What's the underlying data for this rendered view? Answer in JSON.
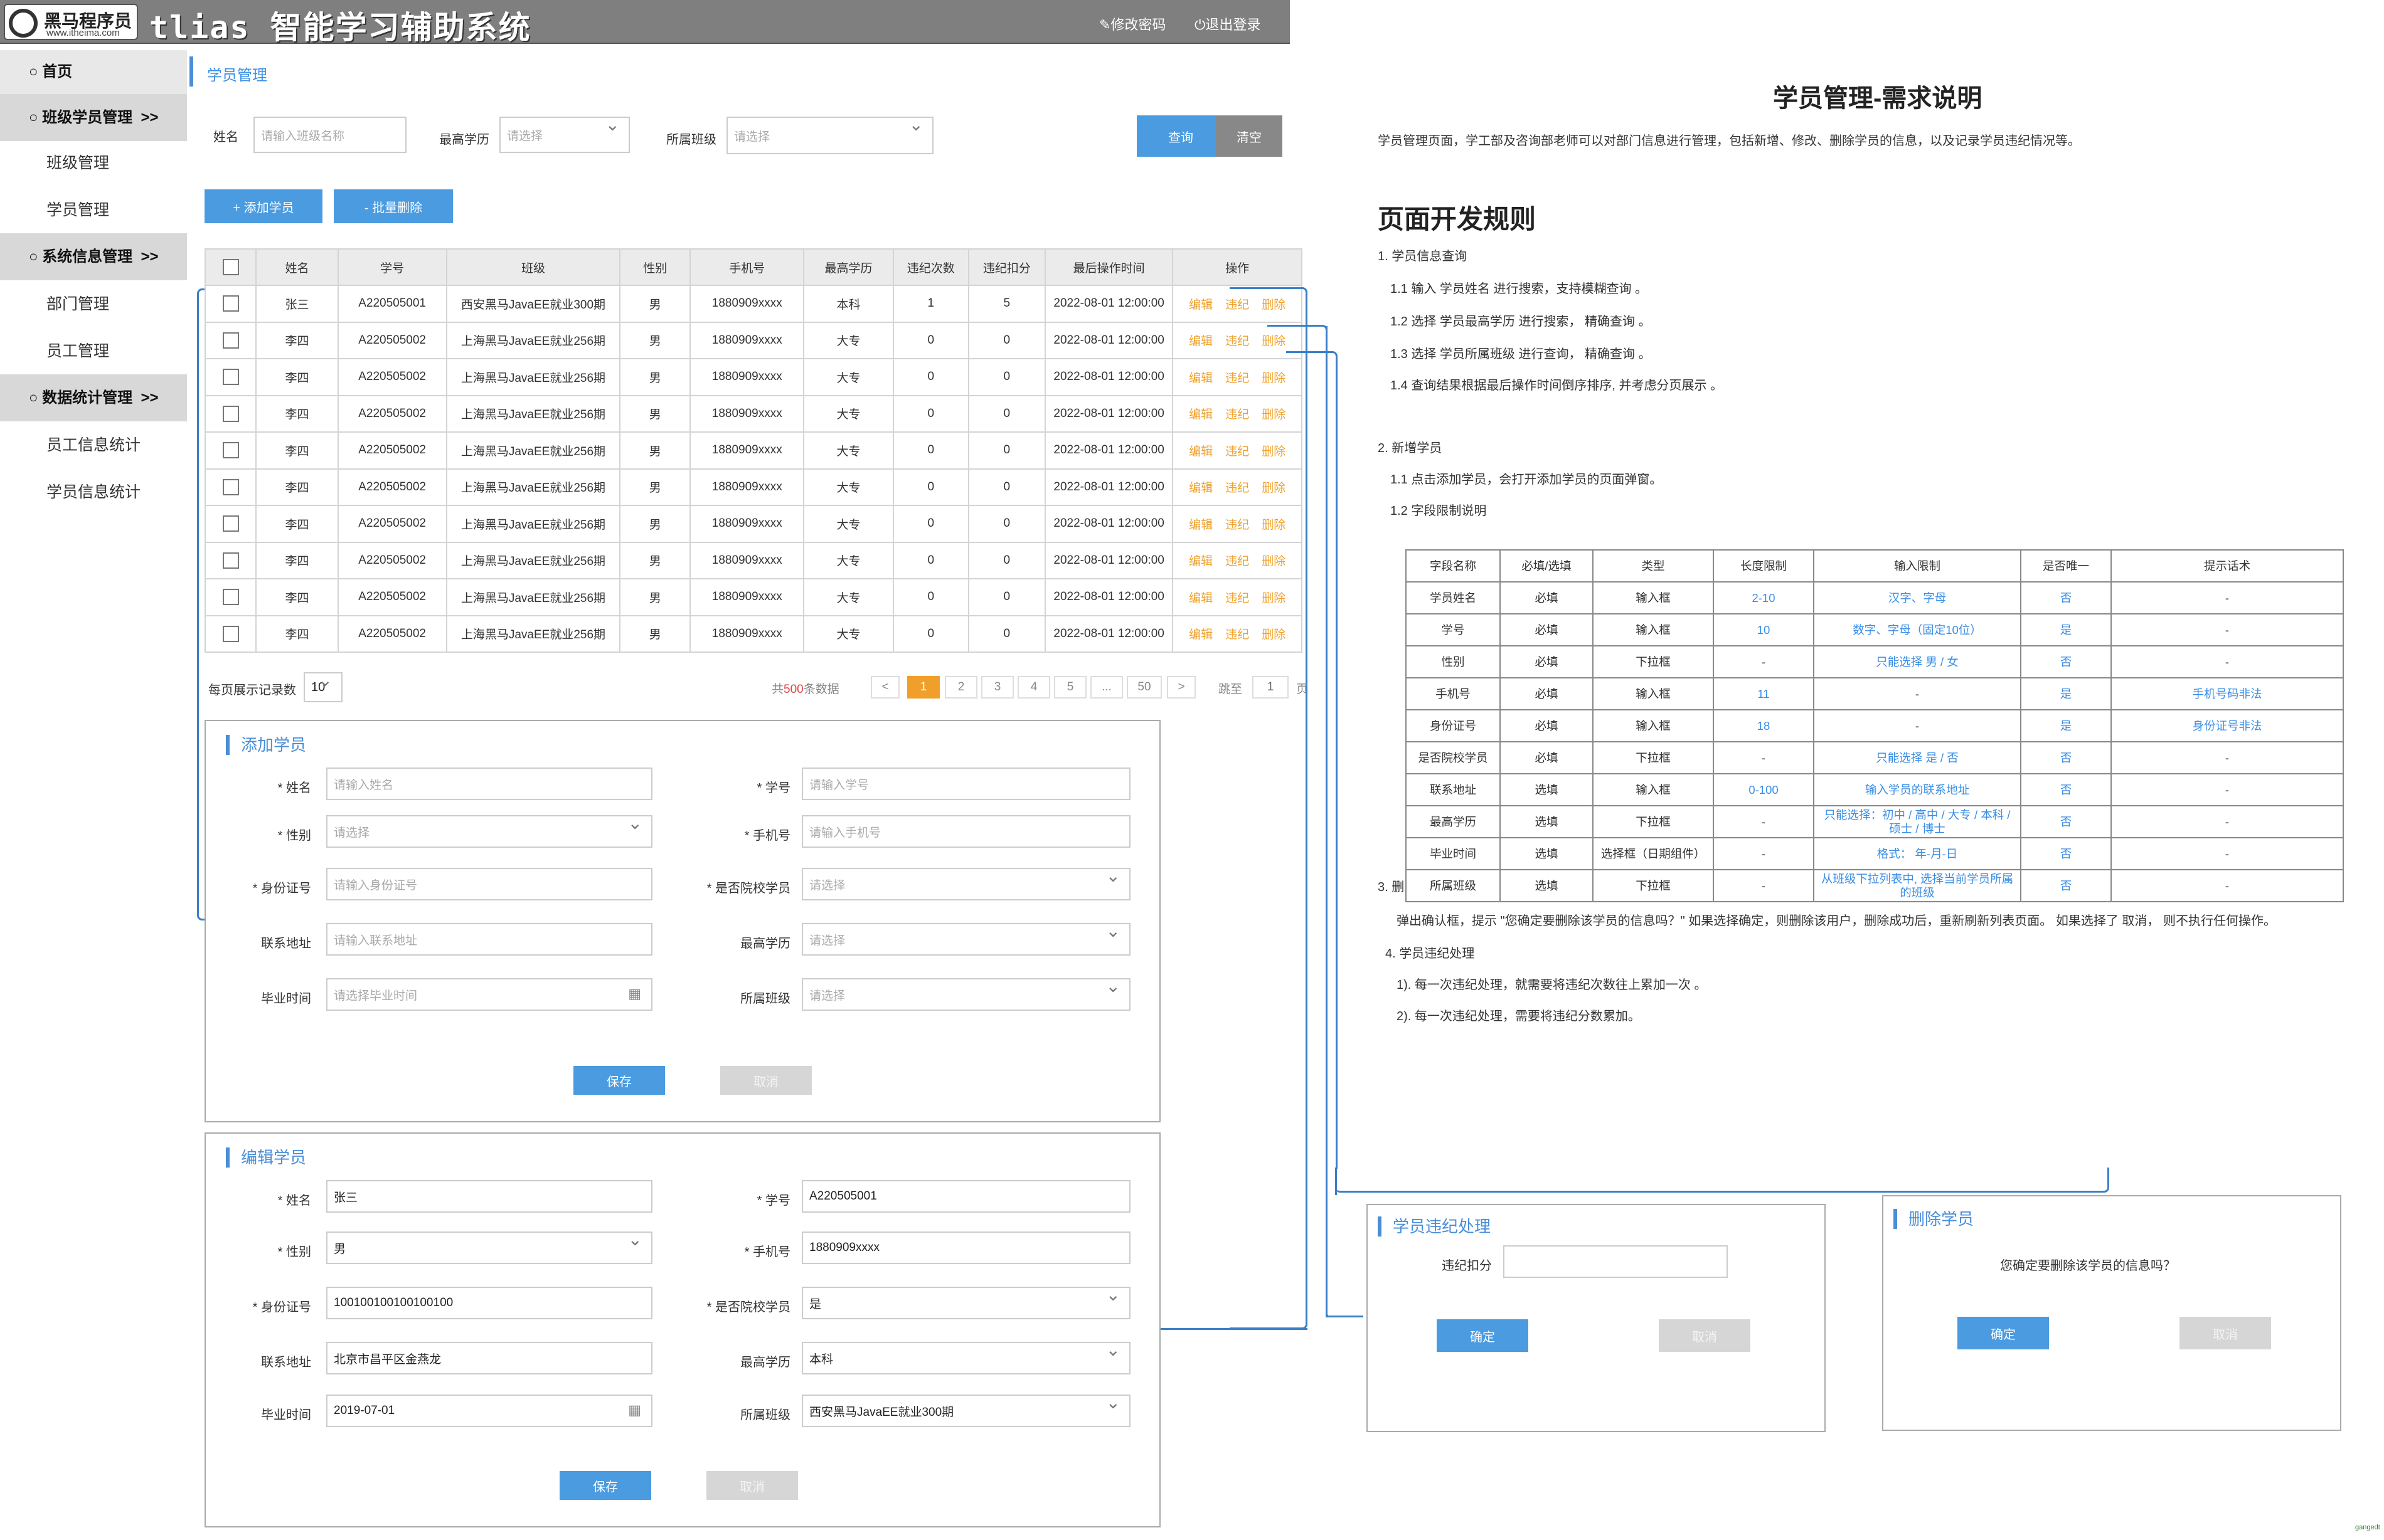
{
  "header": {
    "logo_text": "黑马程序员",
    "logo_sub": "www.itheima.com",
    "app_title": "tlias 智能学习辅助系统",
    "change_password": "修改密码",
    "logout": "退出登录"
  },
  "sidebar": {
    "home": "首页",
    "sections": [
      {
        "label": "班级学员管理",
        "arrow": ">>",
        "items": [
          "班级管理",
          "学员管理"
        ]
      },
      {
        "label": "系统信息管理",
        "arrow": ">>",
        "items": [
          "部门管理",
          "员工管理"
        ]
      },
      {
        "label": "数据统计管理",
        "arrow": ">>",
        "items": [
          "员工信息统计",
          "学员信息统计"
        ]
      }
    ],
    "active_item": "员工信息统计"
  },
  "page_title": "学员管理",
  "search": {
    "name_label": "姓名",
    "name_placeholder": "请输入班级名称",
    "edu_label": "最高学历",
    "edu_placeholder": "请选择",
    "class_label": "所属班级",
    "class_placeholder": "请选择",
    "query": "查询",
    "clear": "清空"
  },
  "actions": {
    "add": "+ 添加学员",
    "batch_delete": "- 批量删除"
  },
  "table": {
    "headers": [
      "姓名",
      "学号",
      "班级",
      "性别",
      "手机号",
      "最高学历",
      "违纪次数",
      "违纪扣分",
      "最后操作时间",
      "操作"
    ],
    "ops": [
      "编辑",
      "违纪",
      "删除"
    ],
    "rows": [
      [
        "张三",
        "A220505001",
        "西安黑马JavaEE就业300期",
        "男",
        "1880909xxxx",
        "本科",
        "1",
        "5",
        "2022-08-01 12:00:00"
      ],
      [
        "李四",
        "A220505002",
        "上海黑马JavaEE就业256期",
        "男",
        "1880909xxxx",
        "大专",
        "0",
        "0",
        "2022-08-01 12:00:00"
      ],
      [
        "李四",
        "A220505002",
        "上海黑马JavaEE就业256期",
        "男",
        "1880909xxxx",
        "大专",
        "0",
        "0",
        "2022-08-01 12:00:00"
      ],
      [
        "李四",
        "A220505002",
        "上海黑马JavaEE就业256期",
        "男",
        "1880909xxxx",
        "大专",
        "0",
        "0",
        "2022-08-01 12:00:00"
      ],
      [
        "李四",
        "A220505002",
        "上海黑马JavaEE就业256期",
        "男",
        "1880909xxxx",
        "大专",
        "0",
        "0",
        "2022-08-01 12:00:00"
      ],
      [
        "李四",
        "A220505002",
        "上海黑马JavaEE就业256期",
        "男",
        "1880909xxxx",
        "大专",
        "0",
        "0",
        "2022-08-01 12:00:00"
      ],
      [
        "李四",
        "A220505002",
        "上海黑马JavaEE就业256期",
        "男",
        "1880909xxxx",
        "大专",
        "0",
        "0",
        "2022-08-01 12:00:00"
      ],
      [
        "李四",
        "A220505002",
        "上海黑马JavaEE就业256期",
        "男",
        "1880909xxxx",
        "大专",
        "0",
        "0",
        "2022-08-01 12:00:00"
      ],
      [
        "李四",
        "A220505002",
        "上海黑马JavaEE就业256期",
        "男",
        "1880909xxxx",
        "大专",
        "0",
        "0",
        "2022-08-01 12:00:00"
      ],
      [
        "李四",
        "A220505002",
        "上海黑马JavaEE就业256期",
        "男",
        "1880909xxxx",
        "大专",
        "0",
        "0",
        "2022-08-01 12:00:00"
      ]
    ]
  },
  "pagination": {
    "per_page_label": "每页展示记录数",
    "per_page": "10",
    "total_prefix": "共",
    "total": "500",
    "total_suffix": "条数据",
    "prev": "<",
    "pages": [
      "1",
      "2",
      "3",
      "4",
      "5",
      "...",
      "50"
    ],
    "next": ">",
    "jump_label": "跳至",
    "jump_value": "1",
    "page_suffix": "页"
  },
  "add_form": {
    "title": "添加学员",
    "fields": {
      "name": {
        "label": "* 姓名",
        "placeholder": "请输入姓名"
      },
      "no": {
        "label": "* 学号",
        "placeholder": "请输入学号"
      },
      "gender": {
        "label": "* 性别",
        "placeholder": "请选择"
      },
      "phone": {
        "label": "* 手机号",
        "placeholder": "请输入手机号"
      },
      "idcard": {
        "label": "* 身份证号",
        "placeholder": "请输入身份证号"
      },
      "alumni": {
        "label": "* 是否院校学员",
        "placeholder": "请选择"
      },
      "address": {
        "label": "联系地址",
        "placeholder": "请输入联系地址"
      },
      "edu": {
        "label": "最高学历",
        "placeholder": "请选择"
      },
      "grad": {
        "label": "毕业时间",
        "placeholder": "请选择毕业时间"
      },
      "class": {
        "label": "所属班级",
        "placeholder": "请选择"
      }
    },
    "save": "保存",
    "cancel": "取消"
  },
  "edit_form": {
    "title": "编辑学员",
    "fields": {
      "name": {
        "label": "* 姓名",
        "value": "张三"
      },
      "no": {
        "label": "* 学号",
        "value": "A220505001"
      },
      "gender": {
        "label": "* 性别",
        "value": "男"
      },
      "phone": {
        "label": "* 手机号",
        "value": "1880909xxxx"
      },
      "idcard": {
        "label": "* 身份证号",
        "value": "100100100100100100"
      },
      "alumni": {
        "label": "* 是否院校学员",
        "value": "是"
      },
      "address": {
        "label": "联系地址",
        "value": "北京市昌平区金燕龙"
      },
      "edu": {
        "label": "最高学历",
        "value": "本科"
      },
      "grad": {
        "label": "毕业时间",
        "value": "2019-07-01"
      },
      "class": {
        "label": "所属班级",
        "value": "西安黑马JavaEE就业300期"
      }
    },
    "save": "保存",
    "cancel": "取消"
  },
  "discipline_dialog": {
    "title": "学员违纪处理",
    "label": "违纪扣分",
    "confirm": "确定",
    "cancel": "取消"
  },
  "delete_dialog": {
    "title": "删除学员",
    "message": "您确定要删除该学员的信息吗？",
    "confirm": "确定",
    "cancel": "取消"
  },
  "doc": {
    "title": "学员管理-需求说明",
    "intro": "学员管理页面，学工部及咨询部老师可以对部门信息进行管理，包括新增、修改、删除学员的信息，以及记录学员违纪情况等。",
    "rules_title": "页面开发规则",
    "s1": "1. 学员信息查询",
    "s1_1": "1.1 输入 学员姓名 进行搜索，支持模糊查询 。",
    "s1_2": "1.2 选择 学员最高学历 进行搜索， 精确查询 。",
    "s1_3": "1.3 选择 学员所属班级 进行查询， 精确查询 。",
    "s1_4": "1.4 查询结果根据最后操作时间倒序排序, 并考虑分页展示 。",
    "s2": "2. 新增学员",
    "s2_1": "1.1 点击添加学员，会打开添加学员的页面弹窗。",
    "s2_2": "1.2 字段限制说明",
    "s3_prefix": "3. 删",
    "s3_text": "弹出确认框，提示 \"您确定要删除该学员的信息吗？\" 如果选择确定，则删除该用户，删除成功后，重新刷新列表页面。 如果选择了 取消， 则不执行任何操作。",
    "s4": "4. 学员违纪处理",
    "s4_1": "1). 每一次违纪处理，就需要将违纪次数往上累加一次 。",
    "s4_2": "2). 每一次违纪处理，需要将违纪分数累加。",
    "req_headers": [
      "字段名称",
      "必填/选填",
      "类型",
      "长度限制",
      "输入限制",
      "是否唯一",
      "提示话术"
    ],
    "req_rows": [
      [
        "学员姓名",
        "必填",
        "输入框",
        "2-10",
        "汉字、字母",
        "否",
        "-"
      ],
      [
        "学号",
        "必填",
        "输入框",
        "10",
        "数字、字母（固定10位）",
        "是",
        "-"
      ],
      [
        "性别",
        "必填",
        "下拉框",
        "-",
        "只能选择 男 / 女",
        "否",
        "-"
      ],
      [
        "手机号",
        "必填",
        "输入框",
        "11",
        "-",
        "是",
        "手机号码非法"
      ],
      [
        "身份证号",
        "必填",
        "输入框",
        "18",
        "-",
        "是",
        "身份证号非法"
      ],
      [
        "是否院校学员",
        "必填",
        "下拉框",
        "-",
        "只能选择 是 / 否",
        "否",
        "-"
      ],
      [
        "联系地址",
        "选填",
        "输入框",
        "0-100",
        "输入学员的联系地址",
        "否",
        "-"
      ],
      [
        "最高学历",
        "选填",
        "下拉框",
        "-",
        "只能选择：初中 / 高中 / 大专 / 本科 / 硕士 / 博士",
        "否",
        "-"
      ],
      [
        "毕业时间",
        "选填",
        "选择框（日期组件）",
        "-",
        "格式： 年-月-日",
        "否",
        "-"
      ],
      [
        "所属班级",
        "选填",
        "下拉框",
        "-",
        "从班级下拉列表中, 选择当前学员所属的班级",
        "否",
        "-"
      ]
    ]
  },
  "watermark": "gangedt",
  "colors": {
    "primary": "#4a9be0",
    "orange": "#f0a02a",
    "header": "#7f7f7f"
  }
}
